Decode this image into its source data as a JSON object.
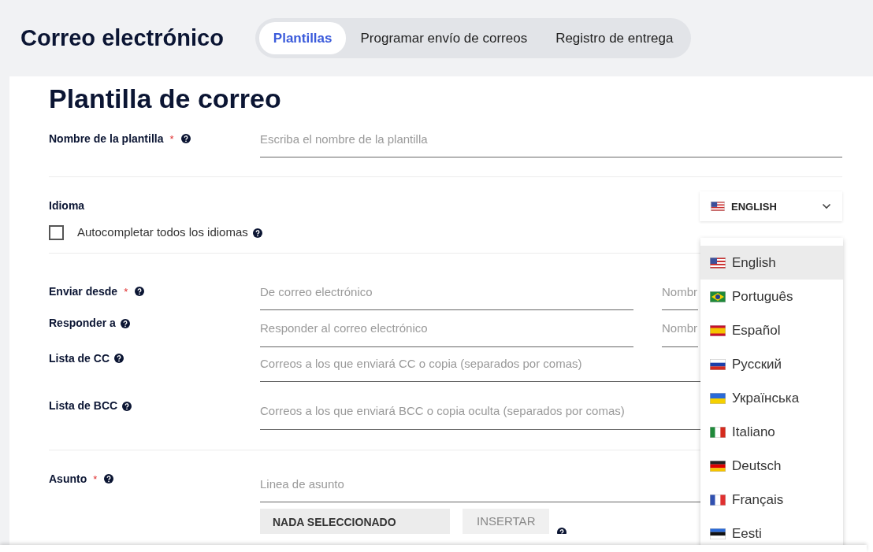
{
  "app_title": "Correo electrónico",
  "tabs": [
    {
      "label": "Plantillas",
      "selected": true
    },
    {
      "label": "Programar envío de correos",
      "selected": false
    },
    {
      "label": "Registro de entrega",
      "selected": false
    }
  ],
  "form": {
    "title": "Plantilla de correo",
    "template_name": {
      "label": "Nombre de la plantilla",
      "required_mark": "*",
      "placeholder": "Escriba el nombre de la plantilla"
    },
    "language": {
      "label": "Idioma",
      "selected_value": "ENGLISH",
      "autocomplete": {
        "label": "Autocompletar todos los idiomas",
        "checked": false
      }
    },
    "send_from": {
      "label": "Enviar desde",
      "required_mark": "*",
      "placeholder": "De correo electrónico",
      "name_placeholder": "Nombr"
    },
    "reply_to": {
      "label": "Responder a",
      "placeholder": "Responder al correo electrónico",
      "name_placeholder": "Nombr"
    },
    "cc": {
      "label": "Lista de CC",
      "placeholder": "Correos a los que enviará CC o copia (separados por comas)"
    },
    "bcc": {
      "label": "Lista de BCC",
      "placeholder": "Correos a los que enviará BCC o copia oculta (separados por comas)"
    },
    "subject": {
      "label": "Asunto",
      "required_mark": "*",
      "placeholder": "Linea de asunto",
      "variable_select": "NADA SELECCIONADO",
      "insert_button": "INSERTAR"
    }
  },
  "language_menu": [
    {
      "label": "English",
      "kind": "us",
      "selected": true
    },
    {
      "label": "Português",
      "kind": "br",
      "selected": false
    },
    {
      "label": "Español",
      "kind": "es",
      "selected": false
    },
    {
      "label": "Русский",
      "kind": "ru",
      "selected": false
    },
    {
      "label": "Українська",
      "kind": "ua",
      "selected": false
    },
    {
      "label": "Italiano",
      "kind": "it",
      "selected": false
    },
    {
      "label": "Deutsch",
      "kind": "de",
      "selected": false
    },
    {
      "label": "Français",
      "kind": "fr",
      "selected": false
    },
    {
      "label": "Eesti",
      "kind": "ee",
      "selected": false
    }
  ]
}
